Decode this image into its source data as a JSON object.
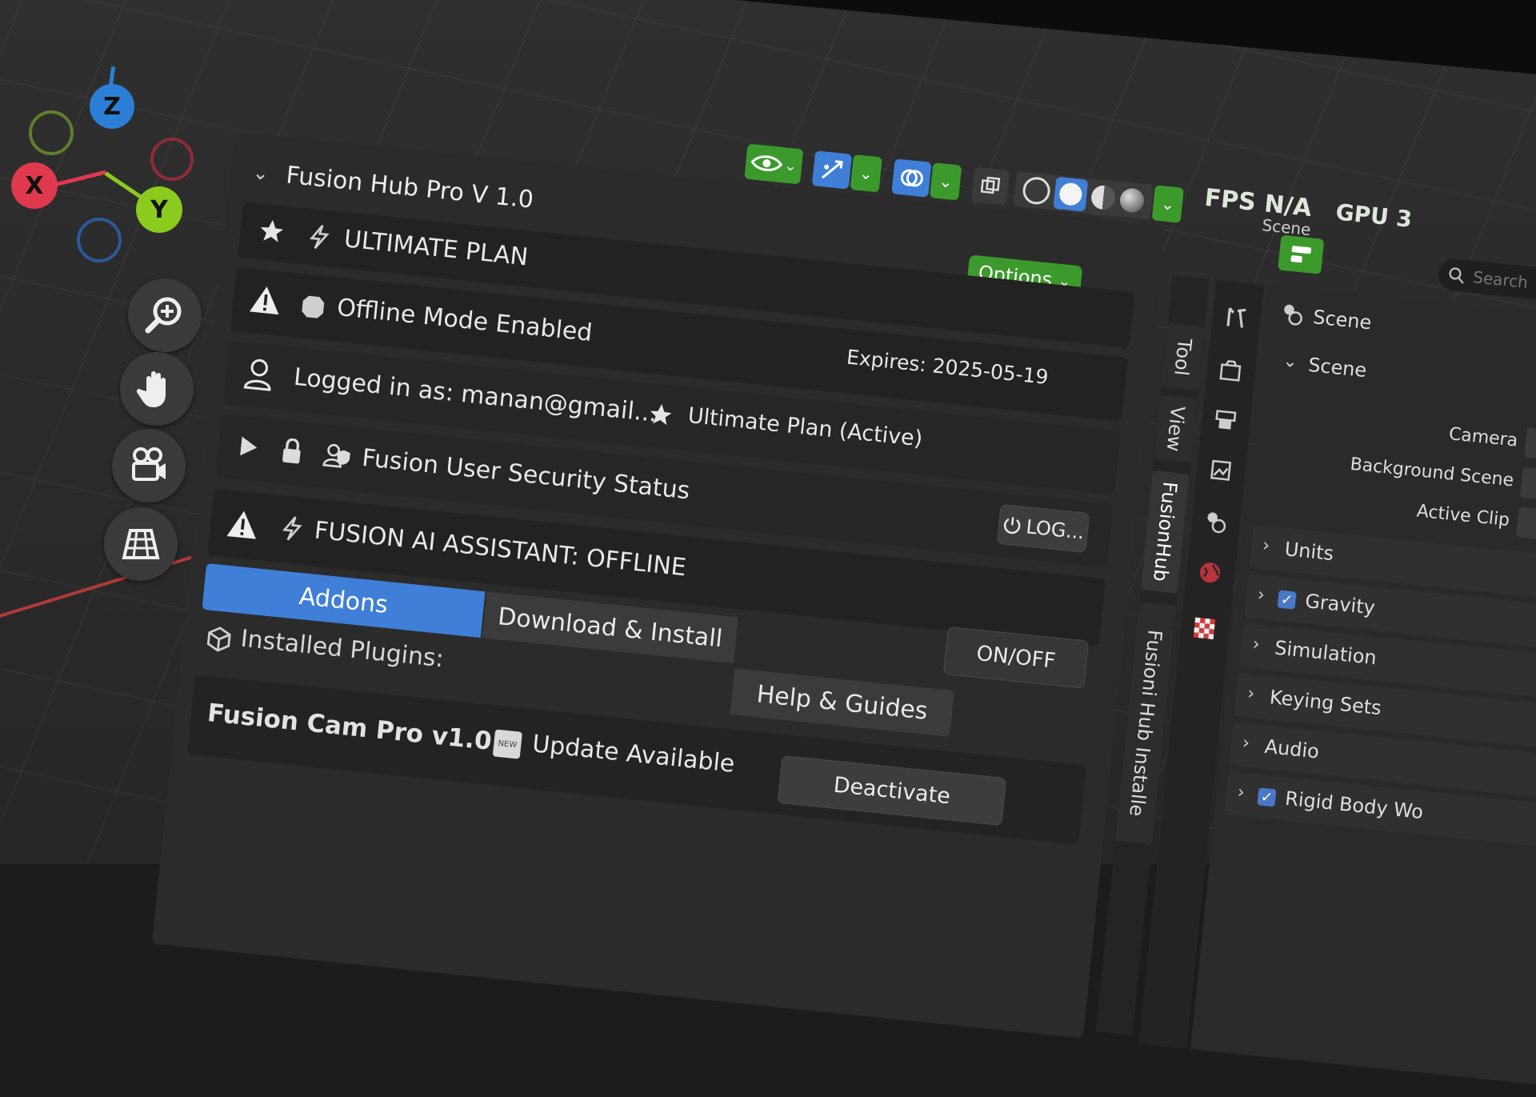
{
  "gizmo": {
    "z_label": "Z",
    "x_label": "X",
    "y_label": "Y"
  },
  "colors": {
    "accent_blue": "#3f7fd8",
    "accent_green": "#3c9a2c",
    "axis_red": "#e0394e",
    "axis_green": "#8acb1e",
    "axis_blue": "#2c7fd6"
  },
  "header": {
    "options_label": "Options",
    "overlay_labels": {
      "fps": "FPS",
      "na": "N/A",
      "scene_small": "Scene",
      "gpu": "GPU 3"
    },
    "search_placeholder": "Search"
  },
  "fusion_panel": {
    "title": "Fusion Hub Pro V 1.0",
    "plan_row": {
      "label": "ULTIMATE PLAN"
    },
    "offline_row": {
      "label": "Offline Mode Enabled",
      "expires": "Expires: 2025-05-19"
    },
    "login_row": {
      "label": "Logged in as: manan@gmail...",
      "plan_status": "Ultimate Plan (Active)"
    },
    "security_row": {
      "label": "Fusion User Security Status",
      "logout_label": "LOG..."
    },
    "ai_row": {
      "label": "FUSION AI ASSISTANT: OFFLINE",
      "toggle_label": "ON/OFF"
    },
    "tabs": [
      "Addons",
      "Download & Install",
      "Help & Guides"
    ],
    "installed_label": "Installed Plugins:",
    "plugin": {
      "name": "Fusion Cam Pro v1.0",
      "badge": "NEW",
      "status": "Update Available",
      "action": "Deactivate"
    }
  },
  "side_tabs": [
    "Tool",
    "View",
    "FusionHub",
    "Fusioni Hub Installe"
  ],
  "properties": {
    "header_label": "Scene",
    "section_label": "Scene",
    "fields": [
      "Camera",
      "Background Scene",
      "Active Clip"
    ],
    "sections": [
      {
        "label": "Units",
        "checked": false
      },
      {
        "label": "Gravity",
        "checked": true
      },
      {
        "label": "Simulation",
        "checked": false
      },
      {
        "label": "Keying Sets",
        "checked": false
      },
      {
        "label": "Audio",
        "checked": false
      },
      {
        "label": "Rigid Body Wo",
        "checked": true
      }
    ]
  }
}
